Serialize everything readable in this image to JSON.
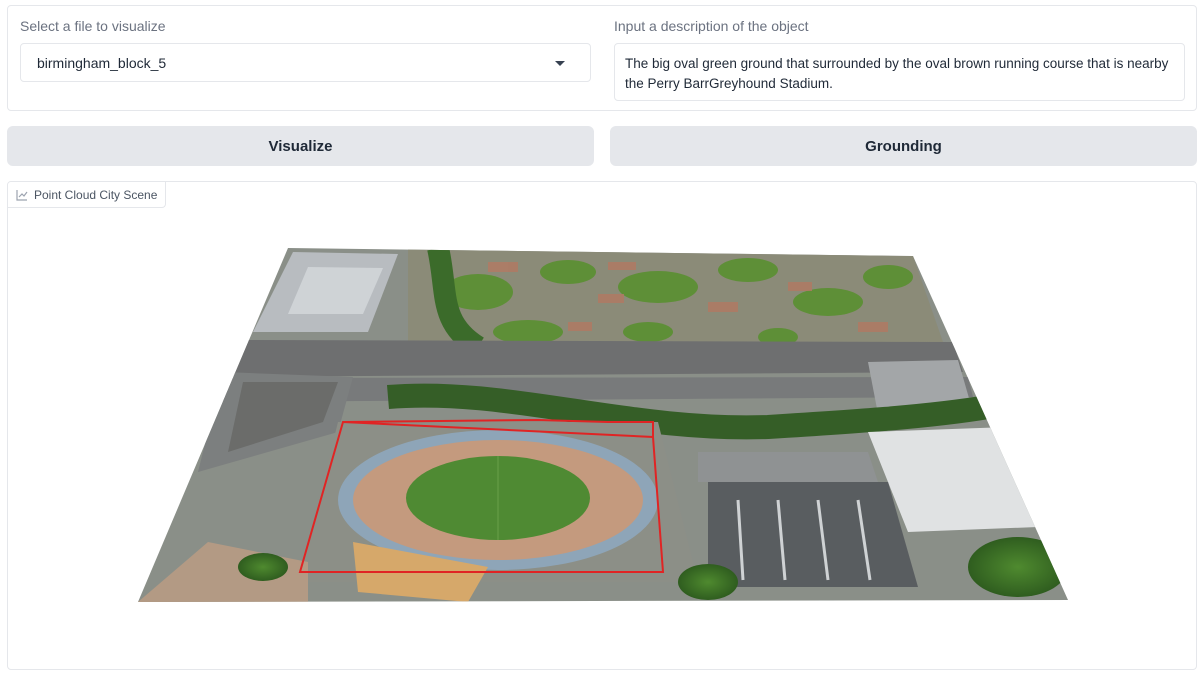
{
  "file_selector": {
    "label": "Select a file to visualize",
    "selected": "birmingham_block_5",
    "icon": "chevron-down-icon"
  },
  "description": {
    "label": "Input a description of the object",
    "value": "The big oval green ground that surrounded by the oval brown running course that is nearby the Perry BarrGreyhound Stadium."
  },
  "buttons": {
    "visualize": "Visualize",
    "grounding": "Grounding"
  },
  "viewer": {
    "title": "Point Cloud City Scene",
    "icon": "chart-icon",
    "highlight_color": "#e02424"
  }
}
